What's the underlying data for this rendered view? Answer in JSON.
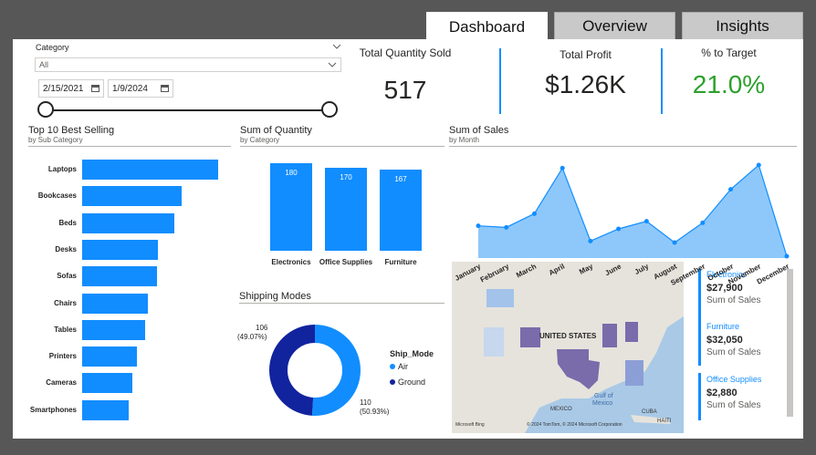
{
  "tabs": [
    {
      "label": "Dashboard",
      "active": true
    },
    {
      "label": "Overview",
      "active": false
    },
    {
      "label": "Insights",
      "active": false
    }
  ],
  "filters": {
    "category_label": "Category",
    "category_value": "All",
    "date_start": "2/15/2021",
    "date_end": "1/9/2024"
  },
  "kpis": {
    "qty_label": "Total Quantity Sold",
    "qty_value": "517",
    "profit_label": "Total Profit",
    "profit_value": "$1.26K",
    "target_label": "% to Target",
    "target_value": "21.0%",
    "target_color": "#2ca02c"
  },
  "top10": {
    "title": "Top 10 Best Selling",
    "subtitle": "by Sub Category"
  },
  "qty_by_category": {
    "title": "Sum of Quantity",
    "subtitle": "by Category"
  },
  "sales_by_month": {
    "title": "Sum of Sales",
    "subtitle": "by Month"
  },
  "shipping": {
    "title": "Shipping Modes",
    "legend_title": "Ship_Mode",
    "air_label": "Air",
    "ground_label": "Ground",
    "ground_value": "106",
    "ground_pct": "(49.07%)",
    "air_value": "110",
    "air_pct": "(50.93%)"
  },
  "map": {
    "label_us": "UNITED STATES",
    "label_mexico": "MEXICO",
    "label_gulf": "Gulf of",
    "label_gulf2": "Mexico",
    "label_cuba": "CUBA",
    "label_haiti": "HAITI",
    "attribution_left": "Microsoft Bing",
    "attribution_right": "© 2024 TomTom, © 2024 Microsoft Corporation"
  },
  "cards": [
    {
      "category": "Electronics",
      "value": "$27,900",
      "label": "Sum of Sales"
    },
    {
      "category": "Furniture",
      "value": "$32,050",
      "label": "Sum of Sales"
    },
    {
      "category": "Office Supplies",
      "value": "$2,880",
      "label": "Sum of Sales"
    }
  ],
  "colors": {
    "accent": "#118dff",
    "dark_blue": "#12239e",
    "area_fill": "#8ec8fb",
    "map_state": "#7a6bab"
  },
  "chart_data": [
    {
      "type": "bar",
      "orientation": "horizontal",
      "title": "Top 10 Best Selling",
      "subtitle": "by Sub Category",
      "categories": [
        "Laptops",
        "Bookcases",
        "Beds",
        "Desks",
        "Sofas",
        "Chairs",
        "Tables",
        "Printers",
        "Cameras",
        "Smartphones"
      ],
      "values": [
        100,
        73,
        68,
        56,
        55,
        48,
        46,
        40,
        37,
        34
      ]
    },
    {
      "type": "bar",
      "title": "Sum of Quantity",
      "subtitle": "by Category",
      "categories": [
        "Electronics",
        "Office Supplies",
        "Furniture"
      ],
      "values": [
        180,
        170,
        167
      ]
    },
    {
      "type": "area",
      "title": "Sum of Sales",
      "subtitle": "by Month",
      "categories": [
        "January",
        "February",
        "March",
        "April",
        "May",
        "June",
        "July",
        "August",
        "September",
        "October",
        "November",
        "December"
      ],
      "values": [
        20,
        19,
        28,
        58,
        10,
        18,
        23,
        9,
        22,
        44,
        60,
        0
      ]
    },
    {
      "type": "pie",
      "donut": true,
      "title": "Shipping Modes",
      "categories": [
        "Air",
        "Ground"
      ],
      "values": [
        110,
        106
      ]
    }
  ]
}
